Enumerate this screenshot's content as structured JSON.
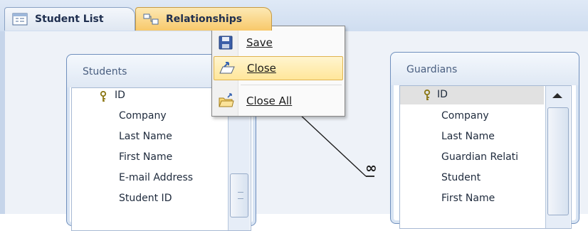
{
  "tabs": [
    {
      "label": "Student List",
      "icon": "form-icon",
      "active": false
    },
    {
      "label": "Relationships",
      "icon": "relationships-icon",
      "active": true
    }
  ],
  "context_menu": {
    "items": [
      {
        "label": "Save",
        "icon": "save-icon"
      },
      {
        "label": "Close",
        "icon": "close-icon",
        "highlighted": true
      },
      {
        "label": "Close All",
        "icon": "close-all-icon"
      }
    ]
  },
  "tables": {
    "students": {
      "title": "Students",
      "fields": [
        "ID",
        "Company",
        "Last Name",
        "First Name",
        "E-mail Address",
        "Student ID"
      ],
      "primary_key": "ID"
    },
    "guardians": {
      "title": "Guardians",
      "fields": [
        "ID",
        "Company",
        "Last Name",
        "Guardian Relati",
        "Student",
        "First Name"
      ],
      "primary_key": "ID",
      "selected_field": "ID"
    }
  },
  "relationship": {
    "many_symbol": "∞"
  },
  "colors": {
    "active_tab": "#f8c96a",
    "menu_highlight": "#ffe69a",
    "table_border": "#6f8fbd"
  }
}
